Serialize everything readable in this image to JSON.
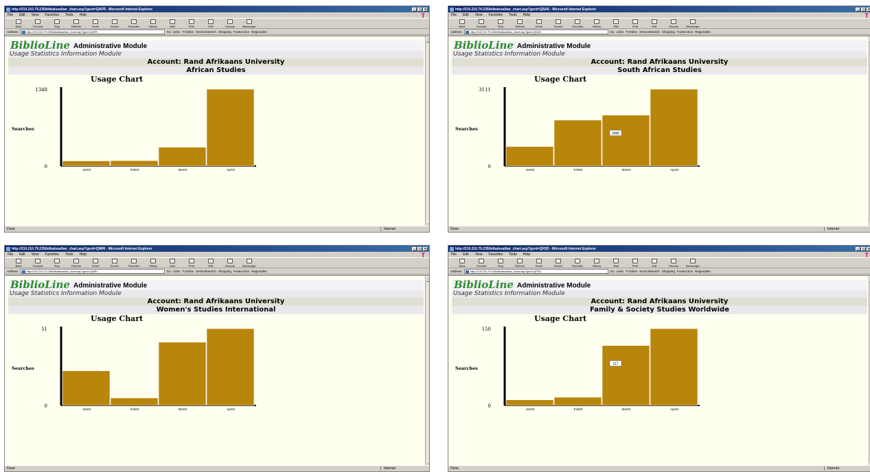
{
  "browser": {
    "window_suffix": " - Microsoft Internet Explorer",
    "menu": [
      "File",
      "Edit",
      "View",
      "Favorites",
      "Tools",
      "Help"
    ],
    "toolbar": [
      "Back",
      "Forward",
      "Stop",
      "Refresh",
      "Home",
      "Search",
      "Favorites",
      "History",
      "Mail",
      "Print",
      "Edit",
      "Discuss",
      "Messenger"
    ],
    "address_label": "Address",
    "go_label": "Go",
    "links_label": "Links",
    "links": [
      "T-Online",
      "Servicebereich",
      "Shopping",
      "Fun&Action",
      "Regionales"
    ],
    "status_text": "Done",
    "zone_text": "Internet",
    "logo_mark": "T"
  },
  "app": {
    "logo": "BiblioLine",
    "title": "Administrative Module",
    "subtitle": "Usage Statistics Information Module",
    "account": "Account: Rand Afrikaans University",
    "chart_title": "Usage Chart"
  },
  "colors": {
    "bar": "#b8860b",
    "axis": "#000000",
    "background": "#fffff0"
  },
  "windows": [
    {
      "title": "http://210.210.79.235/bitbalssa/bar_chart.asp?gsrd=QAFR",
      "url": "http://210.210.79.235/biblalssa/bar_chart.asp?gsrd=QAFR",
      "database": "African Studies",
      "chart_data": {
        "type": "bar",
        "ylabel": "Searches",
        "categories": [
          "Jan03",
          "Feb03",
          "Mar03",
          "Apr03"
        ],
        "values": [
          90,
          95,
          330,
          1348
        ],
        "ylim": [
          0,
          1348
        ],
        "ytick_labels": [
          "0",
          "1348"
        ],
        "annotation": null
      }
    },
    {
      "title": "http://210.210.79.235/bitbalssa/bar_chart.asp?gsrd=QSAS",
      "url": "http://210.210.79.235/biblalssa/bar_chart.asp?gsrd=QSAS",
      "database": "South African Studies",
      "chart_data": {
        "type": "bar",
        "ylabel": "Searches",
        "categories": [
          "Jan03",
          "Feb03",
          "Mar03",
          "Apr03"
        ],
        "values": [
          790,
          1860,
          2060,
          3111
        ],
        "ylim": [
          0,
          3111
        ],
        "ytick_labels": [
          "0",
          "3111"
        ],
        "annotation": "2060"
      }
    },
    {
      "title": "http://210.210.79.235/bitbalssa/bar_chart.asp?gsrd=QWRI",
      "url": "http://210.210.79.235/biblalssa/bar_chart.asp?gsrd=QWRI",
      "database": "Women's Studies International",
      "chart_data": {
        "type": "bar",
        "ylabel": "Searches",
        "categories": [
          "Jan03",
          "Feb03",
          "Mar03",
          "Apr03"
        ],
        "values": [
          23,
          5,
          42,
          51
        ],
        "ylim": [
          0,
          51
        ],
        "ytick_labels": [
          "0",
          "51"
        ],
        "annotation": null
      }
    },
    {
      "title": "http://210.210.79.235/bitbalssa/bar_chart.asp?gsrd=QFSD",
      "url": "http://210.210.79.235/biblalssa/bar_chart.asp?gsrd=QFSD",
      "database": "Family & Society Studies Worldwide",
      "chart_data": {
        "type": "bar",
        "ylabel": "Searches",
        "categories": [
          "Jan03",
          "Feb03",
          "Mar03",
          "Apr03"
        ],
        "values": [
          11,
          16,
          117,
          150
        ],
        "ylim": [
          0,
          150
        ],
        "ytick_labels": [
          "0",
          "150"
        ],
        "annotation": "117"
      }
    }
  ]
}
